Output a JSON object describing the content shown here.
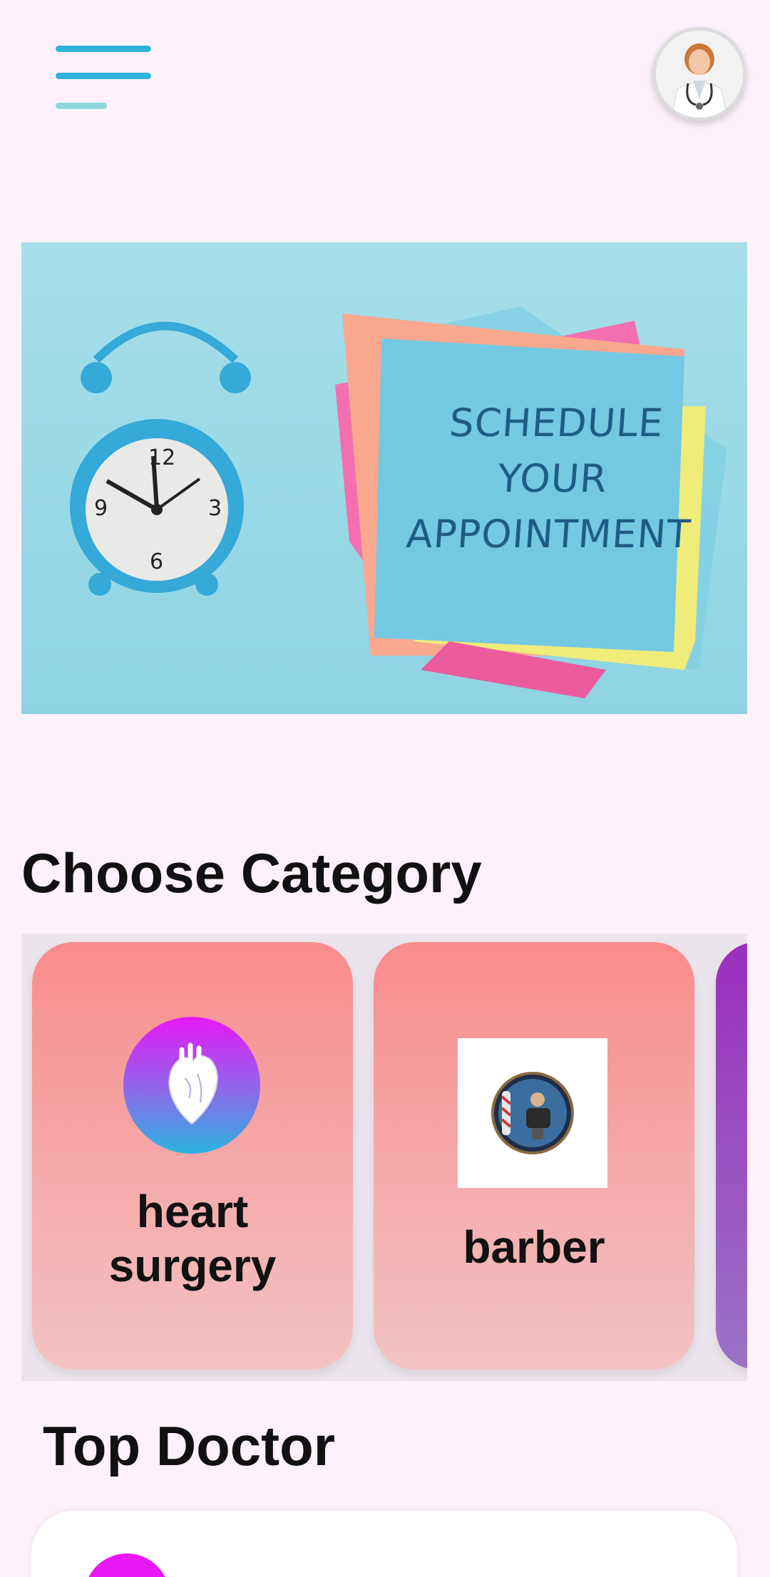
{
  "header": {
    "menu_icon": "hamburger-menu-icon",
    "avatar_icon": "doctor-avatar"
  },
  "banner": {
    "lines": [
      "SCHEDULE",
      "YOUR",
      "APPOINTMENT"
    ]
  },
  "categories_section": {
    "title": "Choose Category",
    "items": [
      {
        "label": "heart\nsurgery",
        "icon": "heart-organ-icon"
      },
      {
        "label": "barber",
        "icon": "barber-shop-icon"
      },
      {
        "label": "",
        "icon": ""
      }
    ]
  },
  "top_doctor_section": {
    "title": "Top Doctor"
  },
  "colors": {
    "background": "#fdf2fc",
    "accent": "#2fb4d9",
    "card_gradient_top": "#f88c8c",
    "card_gradient_bottom": "#f3c3c3",
    "purple_card": "#9b2fbe"
  }
}
